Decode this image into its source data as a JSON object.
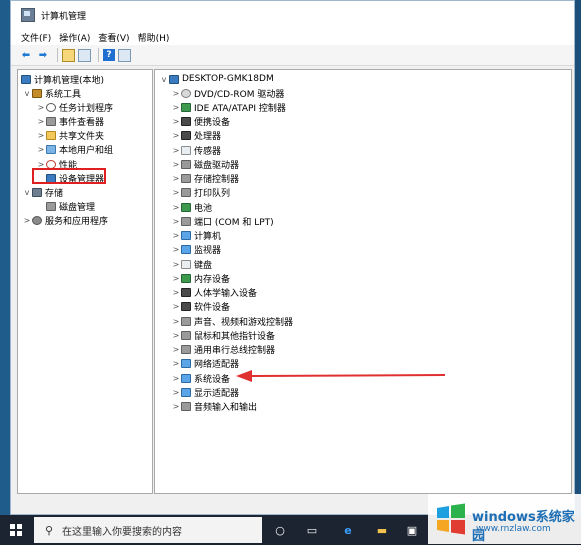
{
  "window": {
    "title": "计算机管理"
  },
  "menu": [
    "文件(F)",
    "操作(A)",
    "查看(V)",
    "帮助(H)"
  ],
  "left_tree": {
    "root": "计算机管理(本地)",
    "items": [
      {
        "label": "系统工具",
        "level": 1,
        "expander": "v",
        "icon": "tools-icon"
      },
      {
        "label": "任务计划程序",
        "level": 2,
        "expander": ">",
        "icon": "clock-icon"
      },
      {
        "label": "事件查看器",
        "level": 2,
        "expander": ">",
        "icon": "event-viewer-icon"
      },
      {
        "label": "共享文件夹",
        "level": 2,
        "expander": ">",
        "icon": "shared-folder-icon"
      },
      {
        "label": "本地用户和组",
        "level": 2,
        "expander": ">",
        "icon": "users-icon"
      },
      {
        "label": "性能",
        "level": 2,
        "expander": ">",
        "icon": "performance-icon"
      },
      {
        "label": "设备管理器",
        "level": 2,
        "expander": "",
        "icon": "device-manager-icon"
      },
      {
        "label": "存储",
        "level": 1,
        "expander": "v",
        "icon": "storage-icon"
      },
      {
        "label": "磁盘管理",
        "level": 2,
        "expander": "",
        "icon": "disk-icon"
      },
      {
        "label": "服务和应用程序",
        "level": 1,
        "expander": ">",
        "icon": "services-icon"
      }
    ]
  },
  "device_tree": {
    "root": "DESKTOP-GMK18DM",
    "items": [
      {
        "label": "DVD/CD-ROM 驱动器",
        "icon": "dvd-icon"
      },
      {
        "label": "IDE ATA/ATAPI 控制器",
        "icon": "ide-controller-icon"
      },
      {
        "label": "便携设备",
        "icon": "portable-device-icon"
      },
      {
        "label": "处理器",
        "icon": "processor-icon"
      },
      {
        "label": "传感器",
        "icon": "sensor-icon"
      },
      {
        "label": "磁盘驱动器",
        "icon": "disk-drive-icon"
      },
      {
        "label": "存储控制器",
        "icon": "storage-controller-icon"
      },
      {
        "label": "打印队列",
        "icon": "printer-icon"
      },
      {
        "label": "电池",
        "icon": "battery-icon"
      },
      {
        "label": "端口 (COM 和 LPT)",
        "icon": "port-icon"
      },
      {
        "label": "计算机",
        "icon": "computer-icon"
      },
      {
        "label": "监视器",
        "icon": "monitor-icon"
      },
      {
        "label": "键盘",
        "icon": "keyboard-icon"
      },
      {
        "label": "内存设备",
        "icon": "memory-icon"
      },
      {
        "label": "人体学输入设备",
        "icon": "hid-icon"
      },
      {
        "label": "软件设备",
        "icon": "software-device-icon"
      },
      {
        "label": "声音、视频和游戏控制器",
        "icon": "sound-icon"
      },
      {
        "label": "鼠标和其他指针设备",
        "icon": "mouse-icon"
      },
      {
        "label": "通用串行总线控制器",
        "icon": "usb-icon"
      },
      {
        "label": "网络适配器",
        "icon": "network-adapter-icon"
      },
      {
        "label": "系统设备",
        "icon": "system-device-icon"
      },
      {
        "label": "显示适配器",
        "icon": "display-adapter-icon"
      },
      {
        "label": "音频输入和输出",
        "icon": "audio-io-icon"
      }
    ]
  },
  "taskbar": {
    "search_placeholder": "在这里输入你要搜索的内容"
  },
  "watermark": {
    "name": "windows系统家园",
    "url": "www.rnzlaw.com"
  }
}
